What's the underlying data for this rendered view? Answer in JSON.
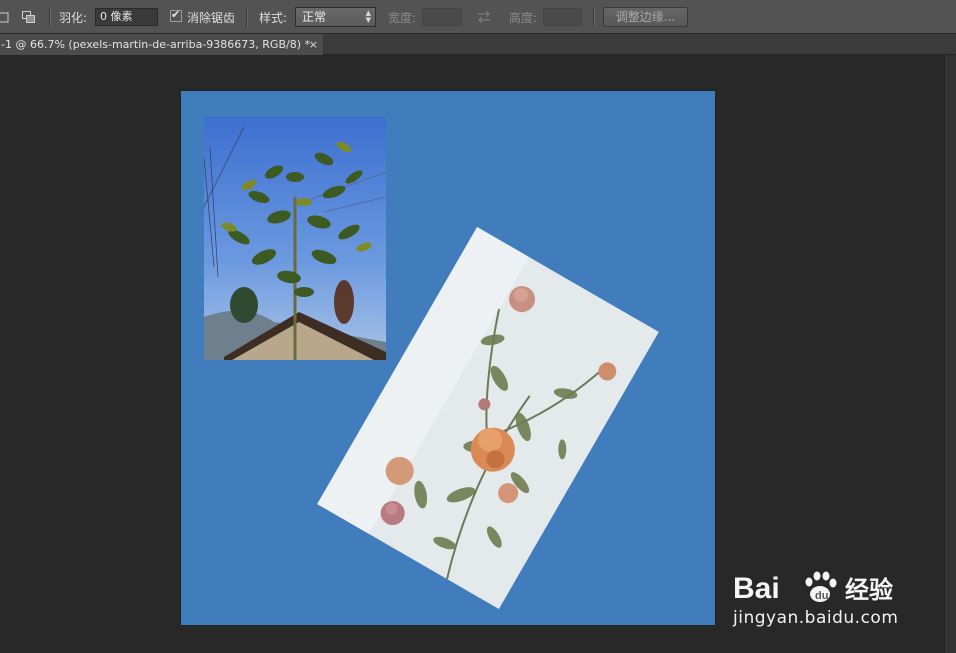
{
  "options_bar": {
    "feather_label": "羽化:",
    "feather_value": "0 像素",
    "antialias_label": "消除锯齿",
    "antialias_checked": true,
    "style_label": "样式:",
    "style_value": "正常",
    "width_label": "宽度:",
    "height_label": "高度:",
    "refine_edge_label": "调整边缘..."
  },
  "document_tab": {
    "title": "-1 @ 66.7% (pexels-martin-de-arriba-9386673, RGB/8) *",
    "close_glyph": "×"
  },
  "canvas": {
    "background_color": "#417cbd"
  },
  "watermark": {
    "logo_text": "Bai 经验",
    "url": "jingyan.baidu.com"
  },
  "icons": [
    "selection-mode-new-icon",
    "selection-mode-intersect-icon",
    "swap-width-height-icon",
    "paw-logo-icon"
  ]
}
